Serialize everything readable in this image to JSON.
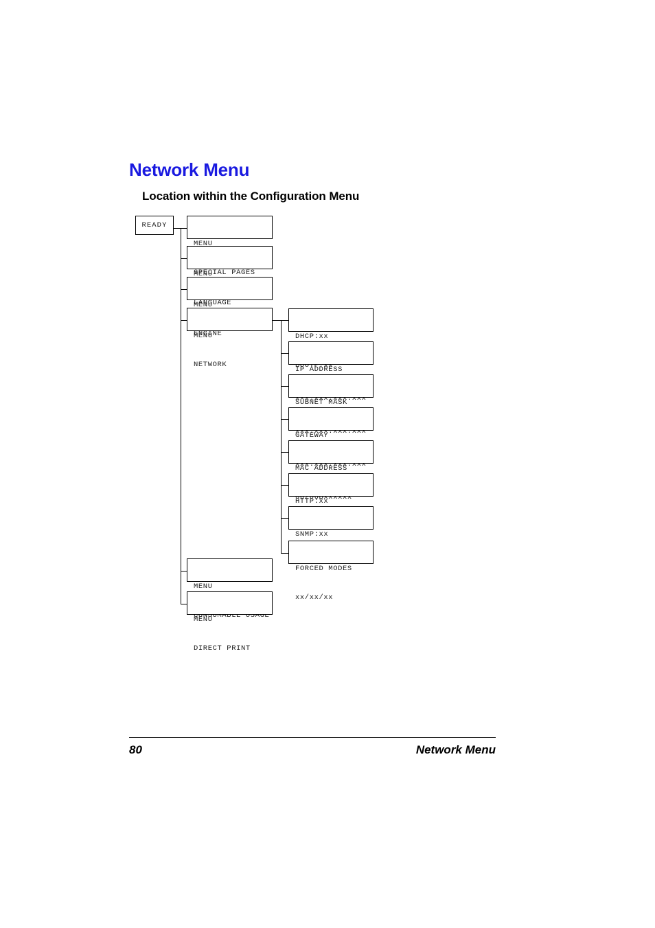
{
  "document": {
    "chapter_title": "Network Menu",
    "section_title": "Location within the Configuration Menu"
  },
  "footer": {
    "page_number": "80",
    "running_title": "Network Menu"
  },
  "diagram": {
    "root": {
      "label": "READY"
    },
    "menu_nodes": [
      {
        "line1": "MENU",
        "line2": "SPECIAL PAGES"
      },
      {
        "line1": "MENU",
        "line2": "LANGUAGE"
      },
      {
        "line1": "MENU",
        "line2": "ENGINE"
      },
      {
        "line1": "MENU",
        "line2": "NETWORK"
      },
      {
        "line1": "MENU",
        "line2": "CONSUMABLE USAGE"
      },
      {
        "line1": "MENU",
        "line2": "DIRECT PRINT"
      }
    ],
    "network_nodes": [
      {
        "line1": "DHCP:xx",
        "line2": "BOOTP:xx"
      },
      {
        "line1": "IP ADDRESS",
        "line2": "xxx.xxx.xxx.xxx"
      },
      {
        "line1": "SUBNET MASK",
        "line2": "xxx.xxx.xxx.xxx"
      },
      {
        "line1": "GATEWAY",
        "line2": "xxx.xxx.xxx.xxx"
      },
      {
        "line1": "MAC ADDRESS",
        "line2": "00206Bxxxxxx"
      },
      {
        "line1": "HTTP:xx",
        "line2": ""
      },
      {
        "line1": "SNMP:xx",
        "line2": ""
      },
      {
        "line1": "FORCED MODES",
        "line2": "xx/xx/xx"
      }
    ]
  }
}
